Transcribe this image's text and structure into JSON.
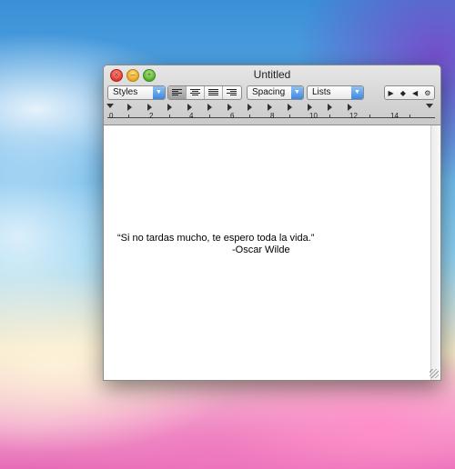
{
  "window": {
    "title": "Untitled"
  },
  "traffic_lights": {
    "close_symbol": "×",
    "minimize_symbol": "–",
    "zoom_symbol": "+"
  },
  "toolbar": {
    "styles_label": "Styles",
    "spacing_label": "Spacing",
    "lists_label": "Lists",
    "alignment": [
      "left",
      "center",
      "justify",
      "right"
    ],
    "selected_alignment": "left",
    "nav_symbols": [
      "▶",
      "◆",
      "◀",
      "⚙"
    ]
  },
  "ruler": {
    "numbers": [
      "0",
      "2",
      "4",
      "6",
      "8",
      "10",
      "12",
      "14"
    ]
  },
  "document": {
    "quote": "“Si no tardas mucho, te espero toda la vida.”",
    "author": "-Oscar Wilde"
  }
}
